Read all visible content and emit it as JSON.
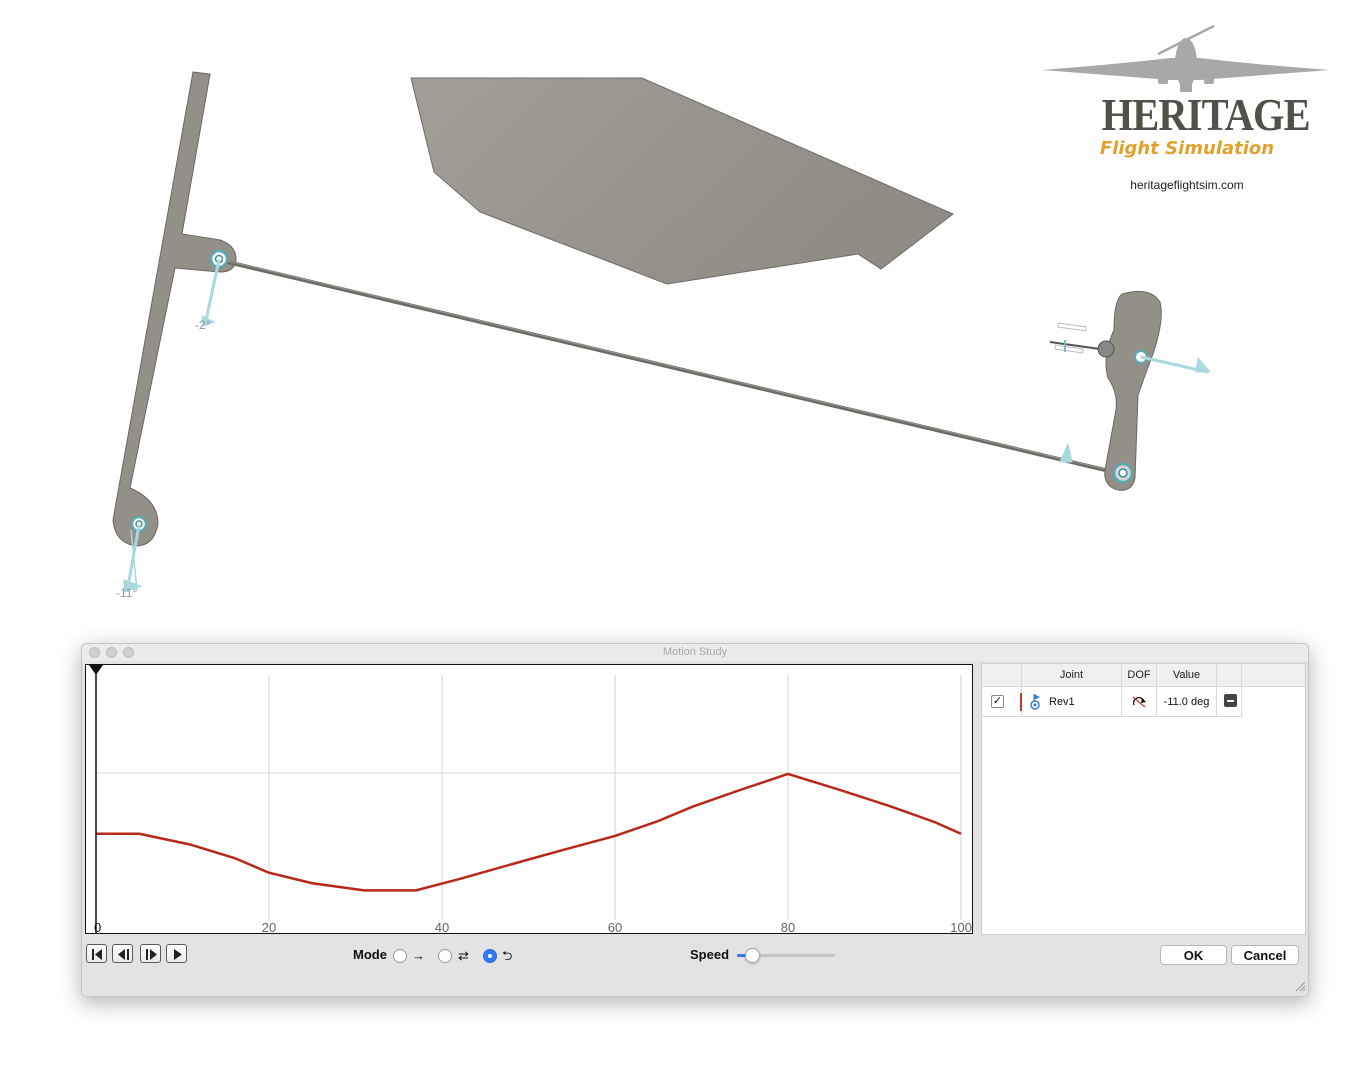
{
  "logo": {
    "title": "HERITAGE",
    "subtitle": "Flight Simulation",
    "url": "heritageflightsim.com"
  },
  "scene": {
    "angle_labels": [
      "-2°",
      "-11°"
    ]
  },
  "window": {
    "title": "Motion Study"
  },
  "chart_data": {
    "type": "line",
    "xlabel": "",
    "ylabel": "",
    "xlim": [
      0,
      100
    ],
    "ylim": [
      0,
      1
    ],
    "x_ticks": [
      0,
      20,
      40,
      60,
      80,
      100
    ],
    "x_tick_labels": [
      "0",
      "20",
      "40",
      "60",
      "80",
      "100"
    ],
    "grid": true,
    "series": [
      {
        "color": "#b82818",
        "x": [
          0,
          5,
          11,
          16,
          20,
          25,
          31,
          37,
          42,
          48,
          54,
          60,
          65,
          69,
          74,
          80,
          86,
          92,
          97,
          100
        ],
        "y": [
          0.352,
          0.352,
          0.307,
          0.253,
          0.193,
          0.15,
          0.121,
          0.121,
          0.167,
          0.227,
          0.286,
          0.343,
          0.404,
          0.463,
          0.525,
          0.596,
          0.531,
          0.462,
          0.399,
          0.352
        ]
      }
    ]
  },
  "joint_table": {
    "headers": {
      "joint": "Joint",
      "dof": "DOF",
      "value": "Value"
    },
    "rows": [
      {
        "checked": "✓",
        "joint": "Rev1",
        "value": "-11.0 deg"
      }
    ]
  },
  "controls": {
    "mode_label": "Mode",
    "mode_selected": "loop",
    "speed_label": "Speed",
    "speed_level": 0.1,
    "ok_label": "OK",
    "cancel_label": "Cancel"
  }
}
